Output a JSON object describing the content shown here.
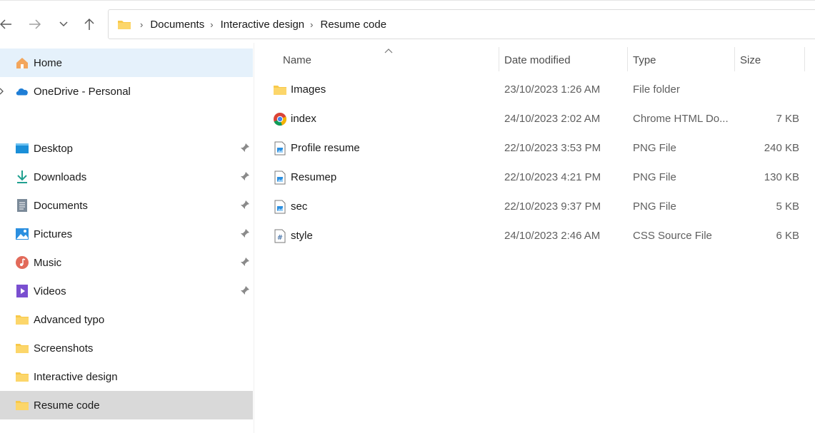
{
  "breadcrumb": {
    "items": [
      "Documents",
      "Interactive design",
      "Resume code"
    ]
  },
  "sidebar": {
    "home": "Home",
    "onedrive": "OneDrive - Personal",
    "quick_access": [
      {
        "label": "Desktop",
        "icon": "desktop-icon",
        "pinned": true
      },
      {
        "label": "Downloads",
        "icon": "download-icon",
        "pinned": true
      },
      {
        "label": "Documents",
        "icon": "documents-icon",
        "pinned": true
      },
      {
        "label": "Pictures",
        "icon": "pictures-icon",
        "pinned": true
      },
      {
        "label": "Music",
        "icon": "music-icon",
        "pinned": true
      },
      {
        "label": "Videos",
        "icon": "videos-icon",
        "pinned": true
      },
      {
        "label": "Advanced typo",
        "icon": "folder-icon",
        "pinned": false
      },
      {
        "label": "Screenshots",
        "icon": "folder-icon",
        "pinned": false
      },
      {
        "label": "Interactive design",
        "icon": "folder-icon",
        "pinned": false
      },
      {
        "label": "Resume code",
        "icon": "folder-icon",
        "pinned": false,
        "selected": true
      }
    ]
  },
  "columns": {
    "name": "Name",
    "date": "Date modified",
    "type": "Type",
    "size": "Size"
  },
  "files": [
    {
      "name": "Images",
      "date": "23/10/2023 1:26 AM",
      "type": "File folder",
      "size": "",
      "icon": "folder-icon"
    },
    {
      "name": "index",
      "date": "24/10/2023 2:02 AM",
      "type": "Chrome HTML Do...",
      "size": "7 KB",
      "icon": "chrome-icon"
    },
    {
      "name": "Profile resume",
      "date": "22/10/2023 3:53 PM",
      "type": "PNG File",
      "size": "240 KB",
      "icon": "png-file-icon"
    },
    {
      "name": "Resumep",
      "date": "22/10/2023 4:21 PM",
      "type": "PNG File",
      "size": "130 KB",
      "icon": "png-file-icon"
    },
    {
      "name": "sec",
      "date": "22/10/2023 9:37 PM",
      "type": "PNG File",
      "size": "5 KB",
      "icon": "png-file-icon"
    },
    {
      "name": "style",
      "date": "24/10/2023 2:46 AM",
      "type": "CSS Source File",
      "size": "6 KB",
      "icon": "css-file-icon"
    }
  ],
  "colors": {
    "home_highlight": "#e5f1fb",
    "selected_bg": "#d9d9d9",
    "folder_yellow": "#f8c94a"
  }
}
